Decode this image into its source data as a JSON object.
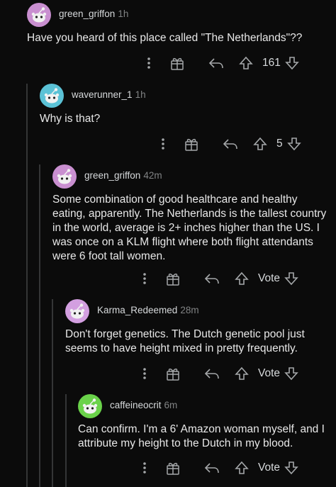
{
  "comments": [
    {
      "username": "green_griffon",
      "time": "1h",
      "body": "Have you heard of this place called \"The Netherlands\"??",
      "votes": "161",
      "avatar_color": "#c98fd0"
    },
    {
      "username": "waverunner_1",
      "time": "1h",
      "body": "Why is that?",
      "votes": "5",
      "avatar_color": "#5bc2d6"
    },
    {
      "username": "green_griffon",
      "time": "42m",
      "body": "Some combination of good healthcare and healthy eating, apparently. The Netherlands is the tallest country in the world, average is 2+ inches higher than the US. I was once on a KLM flight where both flight attendants were 6 foot tall women.",
      "votes": "Vote",
      "avatar_color": "#c98fd0"
    },
    {
      "username": "Karma_Redeemed",
      "time": "28m",
      "body": "Don't forget genetics. The Dutch genetic pool just seems to have height mixed in pretty frequently.",
      "votes": "Vote",
      "avatar_color": "#d39fe0"
    },
    {
      "username": "caffeineocrit",
      "time": "6m",
      "body": "Can confirm. I'm a 6' Amazon woman myself, and I attribute my height to the Dutch in my blood.",
      "votes": "Vote",
      "avatar_color": "#6ad24a"
    }
  ],
  "icons": [
    "more-options-icon",
    "award-icon",
    "reply-icon",
    "upvote-icon",
    "downvote-icon"
  ]
}
